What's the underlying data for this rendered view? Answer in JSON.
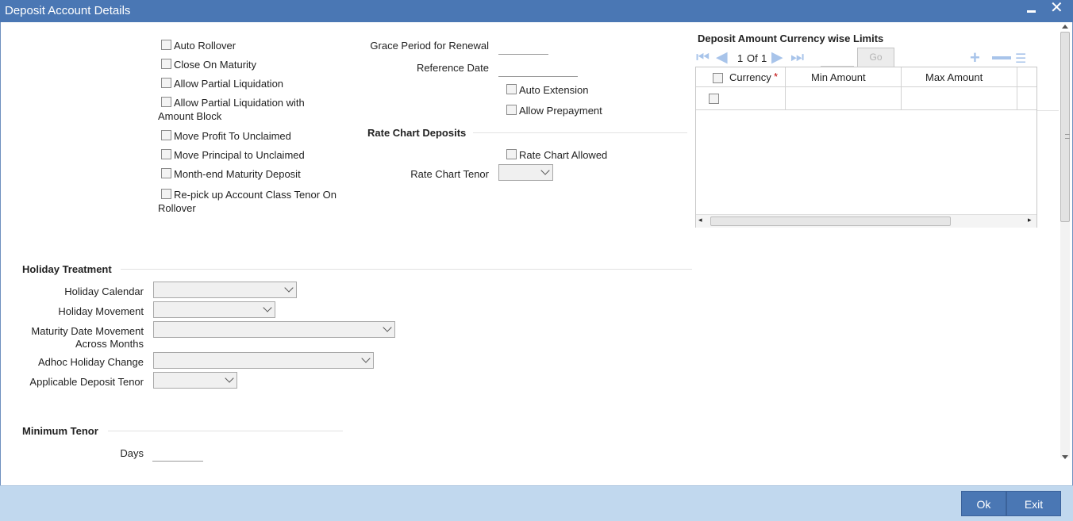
{
  "window": {
    "title": "Deposit Account Details"
  },
  "checkboxes_left": [
    {
      "label": "Auto Rollover"
    },
    {
      "label": "Close On Maturity"
    },
    {
      "label": "Allow Partial Liquidation"
    },
    {
      "label": "Allow Partial Liquidation with",
      "label2": "Amount Block"
    },
    {
      "label": "Move Profit To Unclaimed"
    },
    {
      "label": "Move Principal to Unclaimed"
    },
    {
      "label": "Month-end Maturity Deposit"
    },
    {
      "label": "Re-pick up Account Class Tenor On",
      "label2": "Rollover"
    }
  ],
  "middle": {
    "grace_period_label": "Grace Period for Renewal",
    "reference_date_label": "Reference Date",
    "auto_extension_label": "Auto Extension",
    "allow_prepayment_label": "Allow Prepayment"
  },
  "rate_chart": {
    "heading": "Rate Chart Deposits",
    "allowed_label": "Rate Chart Allowed",
    "tenor_label": "Rate Chart Tenor"
  },
  "limits": {
    "heading": "Deposit Amount Currency wise Limits",
    "pager": {
      "current": "1",
      "of_label": "Of",
      "total": "1",
      "go_label": "Go"
    },
    "columns": [
      "Currency",
      "Min Amount",
      "Max Amount"
    ],
    "required_mark": "*"
  },
  "holiday": {
    "heading": "Holiday Treatment",
    "calendar_label": "Holiday Calendar",
    "movement_label": "Holiday Movement",
    "maturity_label": "Maturity Date Movement",
    "maturity_label2": "Across Months",
    "adhoc_label": "Adhoc Holiday Change",
    "tenor_label": "Applicable Deposit Tenor"
  },
  "min_tenor": {
    "heading": "Minimum Tenor",
    "days_label": "Days"
  },
  "buttons": {
    "ok": "Ok",
    "exit": "Exit"
  },
  "colors": {
    "titlebar": "#4a77b4",
    "footer": "#c1d8ee",
    "button": "#4a77b4",
    "required": "#c00000"
  }
}
